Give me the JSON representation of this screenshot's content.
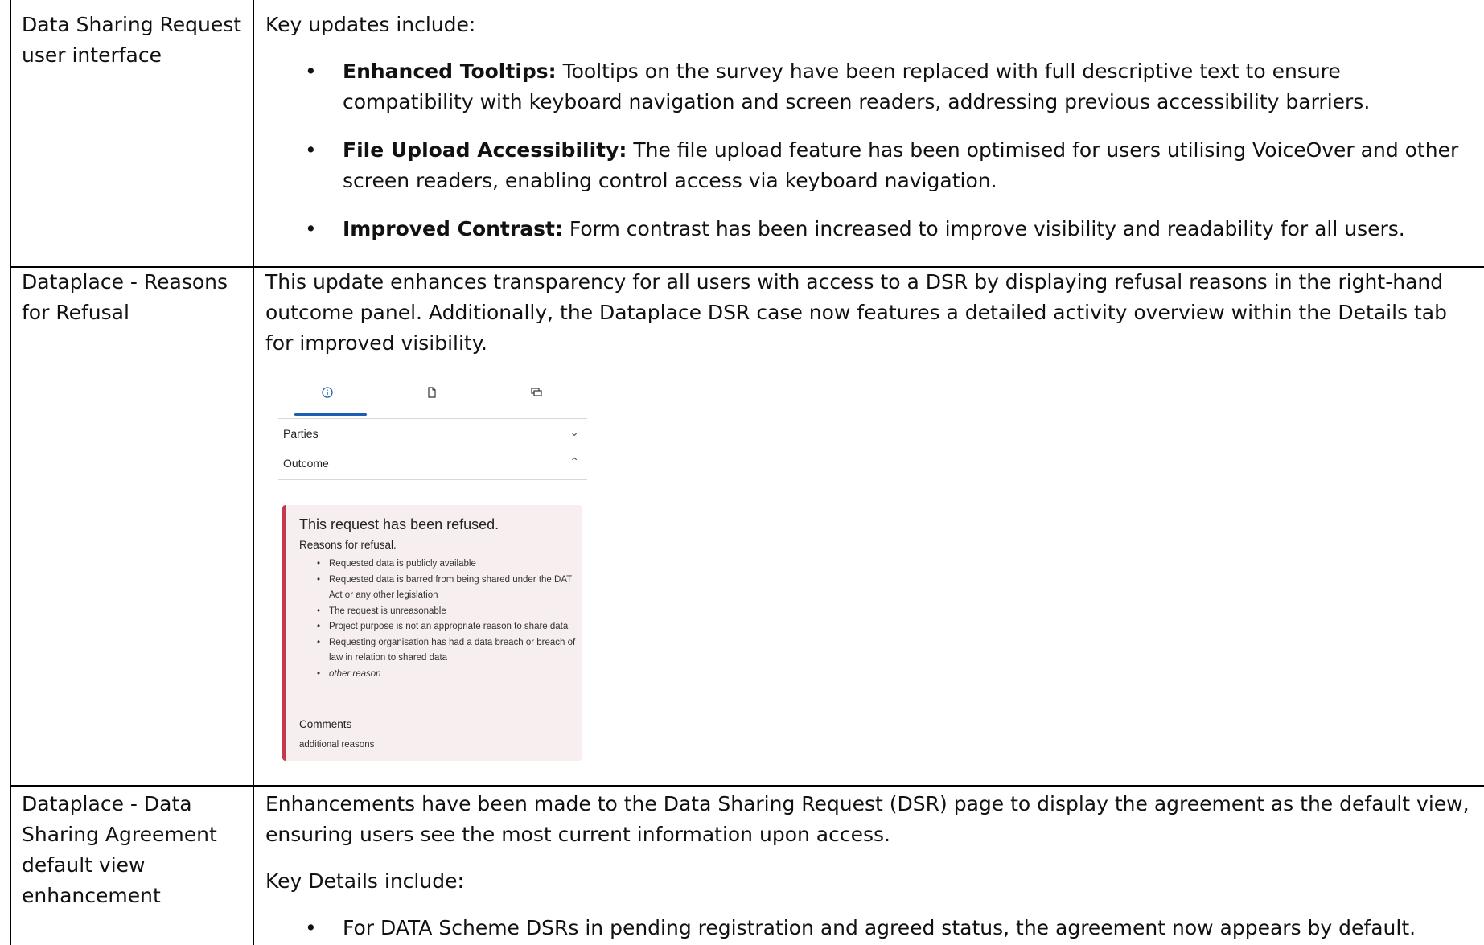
{
  "rows": [
    {
      "label": "Data Sharing Request user interface",
      "intro": "Key updates include:",
      "bullets": [
        {
          "bold": "Enhanced Tooltips:",
          "text": " Tooltips on the survey have been replaced with full descriptive text to ensure compatibility with keyboard navigation and screen readers, addressing previous accessibility barriers."
        },
        {
          "bold": "File Upload Accessibility:",
          "text": " The file upload feature has been optimised for users utilising VoiceOver and other screen readers, enabling control access via keyboard navigation."
        },
        {
          "bold": "Improved Contrast:",
          "text": " Form contrast has been increased to improve visibility and readability for all users."
        }
      ]
    },
    {
      "label": "Dataplace - Reasons for Refusal",
      "text": "This update enhances transparency for all users with access to a DSR by displaying refusal reasons in the right-hand outcome panel. Additionally, the Dataplace DSR case now features a detailed activity overview within the Details tab for improved visibility."
    },
    {
      "label": "Dataplace - Data Sharing Agreement default view enhancement",
      "text": "Enhancements have been made to the Data Sharing Request (DSR) page to display the agreement as the default view, ensuring users see the most current information upon access.",
      "details_intro": "Key Details include:",
      "bullets": [
        {
          "text": "For DATA Scheme DSRs in pending registration and agreed status, the agreement now appears by default."
        }
      ]
    }
  ],
  "screenshot": {
    "tab_icons": [
      "info-icon",
      "document-icon",
      "chat-icon"
    ],
    "accordion": [
      {
        "label": "Parties",
        "state": "collapsed"
      },
      {
        "label": "Outcome",
        "state": "expanded"
      }
    ],
    "refusal": {
      "title": "This request has been refused.",
      "subtitle": "Reasons for refusal.",
      "reasons": [
        "Requested data is publicly available",
        "Requested data is barred from being shared under the DAT Act or any other legislation",
        "The request is unreasonable",
        "Project purpose is not an appropriate reason to share data",
        "Requesting organisation has had a data breach or breach of law in relation to shared data",
        "other reason"
      ],
      "comments_label": "Comments",
      "comments_text": "additional reasons"
    },
    "colors": {
      "accent": "#1a5fb4",
      "refusal_border": "#c5394f",
      "refusal_bg": "#f7eef0"
    }
  }
}
